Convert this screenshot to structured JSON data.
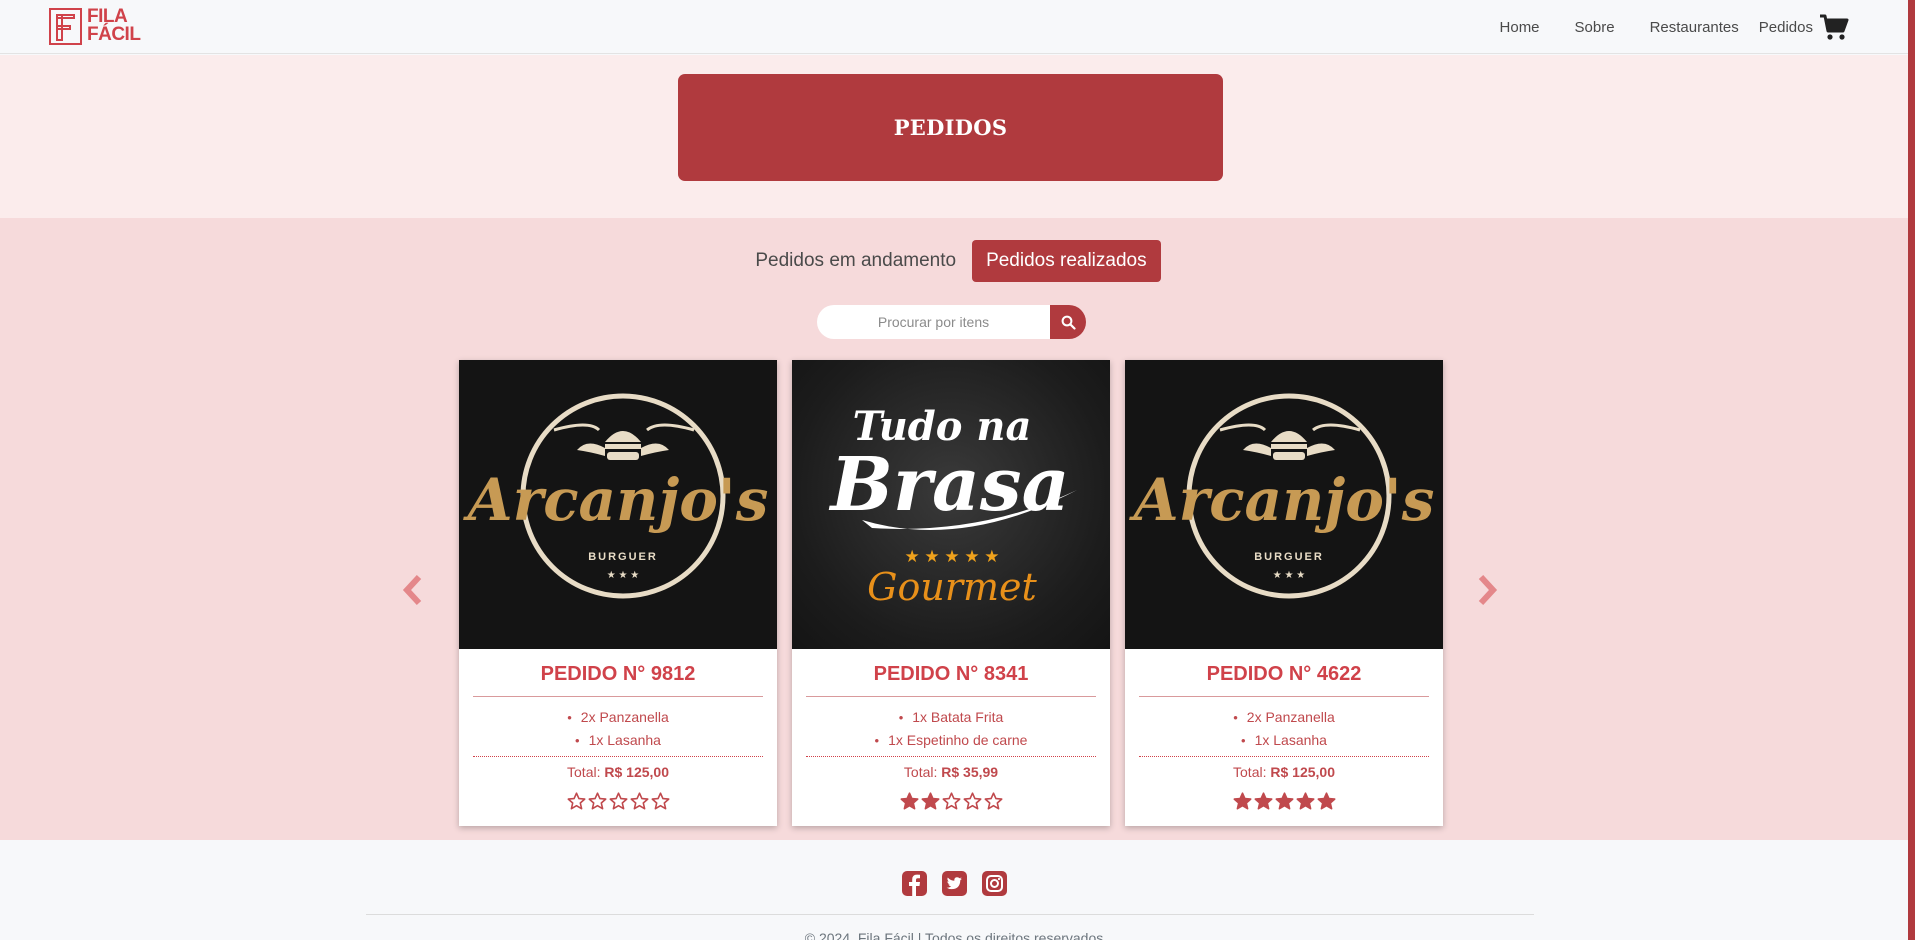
{
  "brand": {
    "line1": "FILA",
    "line2": "FÁCIL"
  },
  "nav": {
    "home": "Home",
    "sobre": "Sobre",
    "restaurantes": "Restaurantes",
    "pedidos": "Pedidos"
  },
  "hero": {
    "title": "PEDIDOS"
  },
  "tabs": {
    "andamento": "Pedidos em andamento",
    "realizados": "Pedidos realizados"
  },
  "search": {
    "placeholder": "Procurar por itens"
  },
  "cards": [
    {
      "logo_main": "Arcanjo's",
      "logo_sub": "BURGUER",
      "title": "PEDIDO N° 9812",
      "items": [
        "2x Panzanella",
        "1x Lasanha"
      ],
      "total_label": "Total:",
      "total_value": "R$ 125,00",
      "rating": 0
    },
    {
      "logo_main": "Tudo na",
      "logo_main2": "Brasa",
      "logo_sub": "Gourmet",
      "title": "PEDIDO N° 8341",
      "items": [
        "1x Batata Frita",
        "1x Espetinho de carne"
      ],
      "total_label": "Total:",
      "total_value": "R$ 35,99",
      "rating": 2
    },
    {
      "logo_main": "Arcanjo's",
      "logo_sub": "BURGUER",
      "title": "PEDIDO N° 4622",
      "items": [
        "2x Panzanella",
        "1x Lasanha"
      ],
      "total_label": "Total:",
      "total_value": "R$ 125,00",
      "rating": 5
    }
  ],
  "footer": {
    "copyright": "© 2024, Fila Fácil | Todos os direitos reservados"
  },
  "colors": {
    "accent": "#b03a3e",
    "brand": "#d0424a",
    "band_light": "#fbecec",
    "band": "#f6dadb"
  },
  "icons": {
    "cart": "shopping-cart-icon",
    "search": "magnifier-icon",
    "prev": "chevron-left-icon",
    "next": "chevron-right-icon",
    "socials": [
      "facebook-icon",
      "twitter-icon",
      "instagram-icon"
    ]
  }
}
